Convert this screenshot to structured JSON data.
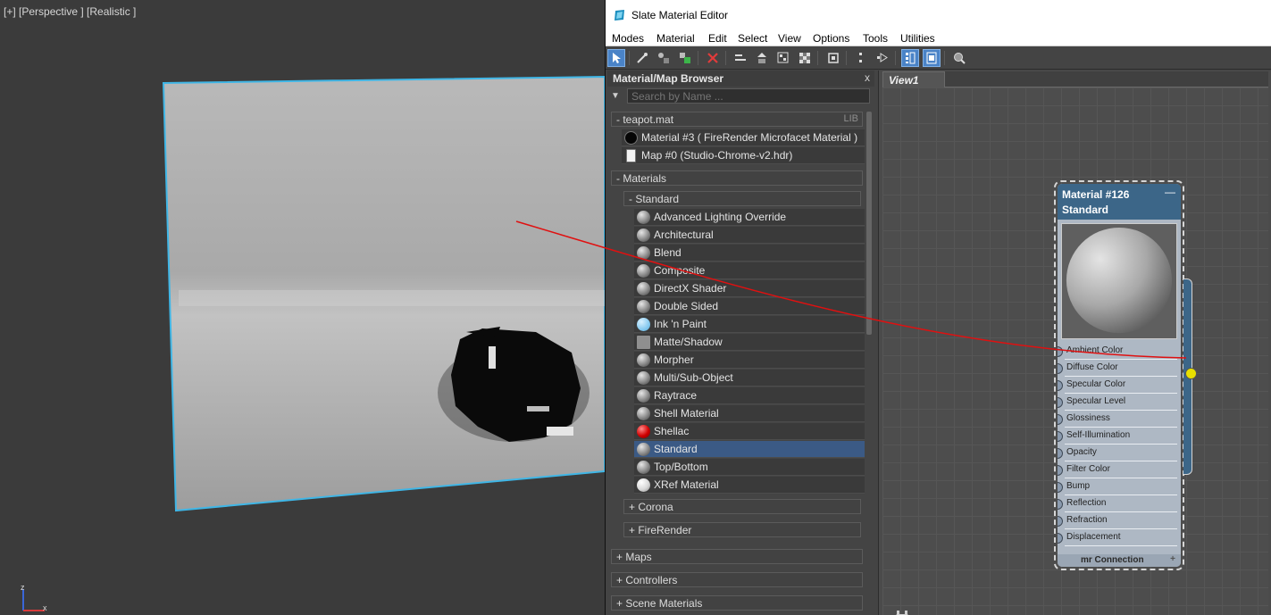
{
  "viewport": {
    "label": "[+] [Perspective ] [Realistic ]",
    "axis_z": "z",
    "axis_x": "x"
  },
  "window": {
    "title": "Slate Material Editor"
  },
  "menu": [
    "Modes",
    "Material",
    "Edit",
    "Select",
    "View",
    "Options",
    "Tools",
    "Utilities"
  ],
  "browser": {
    "title": "Material/Map Browser",
    "close": "x",
    "search_placeholder": "Search by Name ...",
    "library": {
      "header": "- teapot.mat",
      "tag": "LIB",
      "items": [
        {
          "label": "Material #3  ( FireRender Microfacet Material )",
          "icon": "black-sphere"
        },
        {
          "label": "Map #0 (Studio-Chrome-v2.hdr)",
          "icon": "bitmap-icon"
        }
      ]
    },
    "materials_header": "- Materials",
    "standard_header": "- Standard",
    "standard_items": [
      {
        "label": "Advanced Lighting Override",
        "icon": "grey-sphere"
      },
      {
        "label": "Architectural",
        "icon": "grey-sphere"
      },
      {
        "label": "Blend",
        "icon": "grey-sphere"
      },
      {
        "label": "Composite",
        "icon": "grey-sphere"
      },
      {
        "label": "DirectX Shader",
        "icon": "grey-sphere"
      },
      {
        "label": "Double Sided",
        "icon": "grey-sphere"
      },
      {
        "label": "Ink 'n Paint",
        "icon": "light-blue-sphere"
      },
      {
        "label": "Matte/Shadow",
        "icon": "grey-square"
      },
      {
        "label": "Morpher",
        "icon": "grey-sphere"
      },
      {
        "label": "Multi/Sub-Object",
        "icon": "grey-sphere"
      },
      {
        "label": "Raytrace",
        "icon": "grey-sphere"
      },
      {
        "label": "Shell Material",
        "icon": "grey-sphere"
      },
      {
        "label": "Shellac",
        "icon": "red-sphere"
      },
      {
        "label": "Standard",
        "icon": "grey-sphere",
        "selected": true
      },
      {
        "label": "Top/Bottom",
        "icon": "grey-sphere"
      },
      {
        "label": "XRef Material",
        "icon": "white-sphere"
      }
    ],
    "sub_groups": [
      "+ Corona",
      "+ FireRender"
    ],
    "groups": [
      "+ Maps",
      "+ Controllers",
      "+ Scene Materials"
    ]
  },
  "view": {
    "tab": "View1"
  },
  "node": {
    "name": "Material #126",
    "type": "Standard",
    "minimize": "—",
    "slots": [
      "Ambient Color",
      "Diffuse Color",
      "Specular Color",
      "Specular Level",
      "Glossiness",
      "Self-Illumination",
      "Opacity",
      "Filter Color",
      "Bump",
      "Reflection",
      "Refraction",
      "Displacement"
    ],
    "footer": "mr Connection",
    "footer_plus": "+"
  },
  "colors": {
    "node_header": "#3c6688",
    "selection": "#3b5a85",
    "wire": "#e01010",
    "output_socket": "#e8e000",
    "frame_outline": "#3fb6e6"
  }
}
